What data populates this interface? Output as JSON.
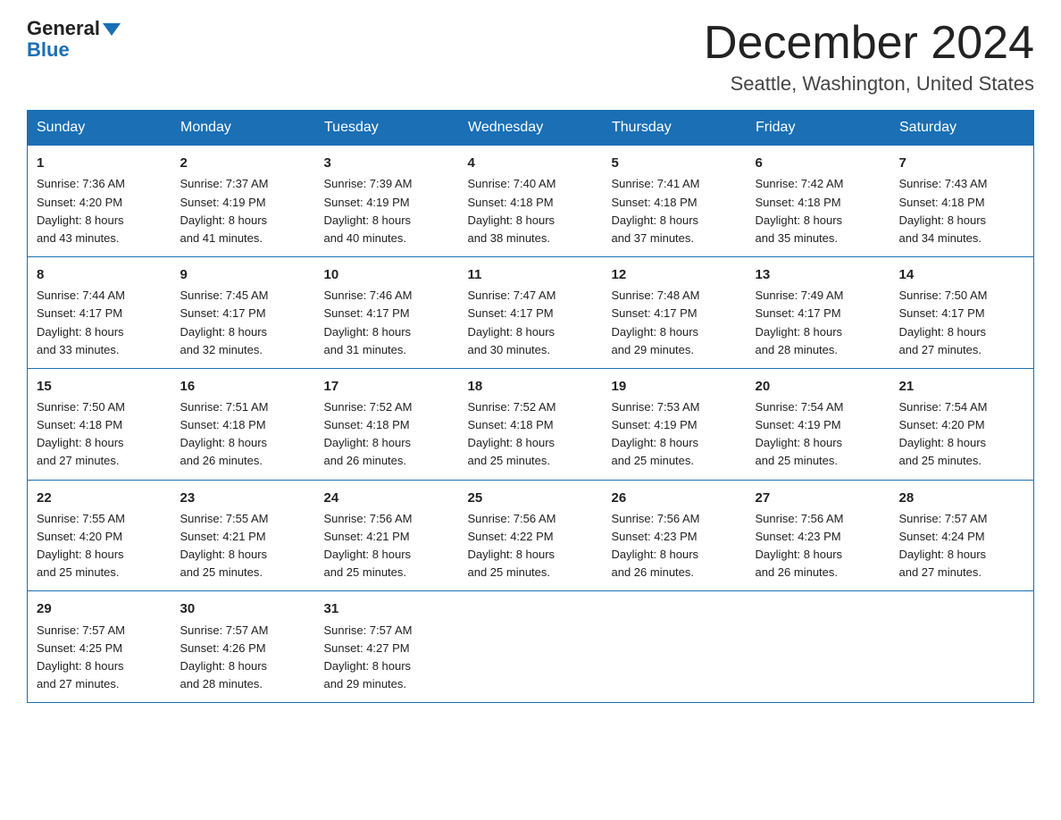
{
  "logo": {
    "general": "General",
    "blue": "Blue"
  },
  "title": "December 2024",
  "location": "Seattle, Washington, United States",
  "weekdays": [
    "Sunday",
    "Monday",
    "Tuesday",
    "Wednesday",
    "Thursday",
    "Friday",
    "Saturday"
  ],
  "weeks": [
    [
      {
        "day": "1",
        "sunrise": "7:36 AM",
        "sunset": "4:20 PM",
        "daylight": "8 hours and 43 minutes."
      },
      {
        "day": "2",
        "sunrise": "7:37 AM",
        "sunset": "4:19 PM",
        "daylight": "8 hours and 41 minutes."
      },
      {
        "day": "3",
        "sunrise": "7:39 AM",
        "sunset": "4:19 PM",
        "daylight": "8 hours and 40 minutes."
      },
      {
        "day": "4",
        "sunrise": "7:40 AM",
        "sunset": "4:18 PM",
        "daylight": "8 hours and 38 minutes."
      },
      {
        "day": "5",
        "sunrise": "7:41 AM",
        "sunset": "4:18 PM",
        "daylight": "8 hours and 37 minutes."
      },
      {
        "day": "6",
        "sunrise": "7:42 AM",
        "sunset": "4:18 PM",
        "daylight": "8 hours and 35 minutes."
      },
      {
        "day": "7",
        "sunrise": "7:43 AM",
        "sunset": "4:18 PM",
        "daylight": "8 hours and 34 minutes."
      }
    ],
    [
      {
        "day": "8",
        "sunrise": "7:44 AM",
        "sunset": "4:17 PM",
        "daylight": "8 hours and 33 minutes."
      },
      {
        "day": "9",
        "sunrise": "7:45 AM",
        "sunset": "4:17 PM",
        "daylight": "8 hours and 32 minutes."
      },
      {
        "day": "10",
        "sunrise": "7:46 AM",
        "sunset": "4:17 PM",
        "daylight": "8 hours and 31 minutes."
      },
      {
        "day": "11",
        "sunrise": "7:47 AM",
        "sunset": "4:17 PM",
        "daylight": "8 hours and 30 minutes."
      },
      {
        "day": "12",
        "sunrise": "7:48 AM",
        "sunset": "4:17 PM",
        "daylight": "8 hours and 29 minutes."
      },
      {
        "day": "13",
        "sunrise": "7:49 AM",
        "sunset": "4:17 PM",
        "daylight": "8 hours and 28 minutes."
      },
      {
        "day": "14",
        "sunrise": "7:50 AM",
        "sunset": "4:17 PM",
        "daylight": "8 hours and 27 minutes."
      }
    ],
    [
      {
        "day": "15",
        "sunrise": "7:50 AM",
        "sunset": "4:18 PM",
        "daylight": "8 hours and 27 minutes."
      },
      {
        "day": "16",
        "sunrise": "7:51 AM",
        "sunset": "4:18 PM",
        "daylight": "8 hours and 26 minutes."
      },
      {
        "day": "17",
        "sunrise": "7:52 AM",
        "sunset": "4:18 PM",
        "daylight": "8 hours and 26 minutes."
      },
      {
        "day": "18",
        "sunrise": "7:52 AM",
        "sunset": "4:18 PM",
        "daylight": "8 hours and 25 minutes."
      },
      {
        "day": "19",
        "sunrise": "7:53 AM",
        "sunset": "4:19 PM",
        "daylight": "8 hours and 25 minutes."
      },
      {
        "day": "20",
        "sunrise": "7:54 AM",
        "sunset": "4:19 PM",
        "daylight": "8 hours and 25 minutes."
      },
      {
        "day": "21",
        "sunrise": "7:54 AM",
        "sunset": "4:20 PM",
        "daylight": "8 hours and 25 minutes."
      }
    ],
    [
      {
        "day": "22",
        "sunrise": "7:55 AM",
        "sunset": "4:20 PM",
        "daylight": "8 hours and 25 minutes."
      },
      {
        "day": "23",
        "sunrise": "7:55 AM",
        "sunset": "4:21 PM",
        "daylight": "8 hours and 25 minutes."
      },
      {
        "day": "24",
        "sunrise": "7:56 AM",
        "sunset": "4:21 PM",
        "daylight": "8 hours and 25 minutes."
      },
      {
        "day": "25",
        "sunrise": "7:56 AM",
        "sunset": "4:22 PM",
        "daylight": "8 hours and 25 minutes."
      },
      {
        "day": "26",
        "sunrise": "7:56 AM",
        "sunset": "4:23 PM",
        "daylight": "8 hours and 26 minutes."
      },
      {
        "day": "27",
        "sunrise": "7:56 AM",
        "sunset": "4:23 PM",
        "daylight": "8 hours and 26 minutes."
      },
      {
        "day": "28",
        "sunrise": "7:57 AM",
        "sunset": "4:24 PM",
        "daylight": "8 hours and 27 minutes."
      }
    ],
    [
      {
        "day": "29",
        "sunrise": "7:57 AM",
        "sunset": "4:25 PM",
        "daylight": "8 hours and 27 minutes."
      },
      {
        "day": "30",
        "sunrise": "7:57 AM",
        "sunset": "4:26 PM",
        "daylight": "8 hours and 28 minutes."
      },
      {
        "day": "31",
        "sunrise": "7:57 AM",
        "sunset": "4:27 PM",
        "daylight": "8 hours and 29 minutes."
      },
      null,
      null,
      null,
      null
    ]
  ],
  "labels": {
    "sunrise": "Sunrise: ",
    "sunset": "Sunset: ",
    "daylight": "Daylight: "
  }
}
